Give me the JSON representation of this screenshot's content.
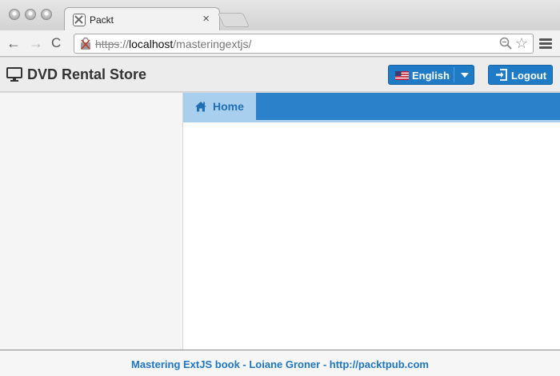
{
  "browser": {
    "tab": {
      "title": "Packt",
      "close_glyph": "×",
      "favicon": "packt-favicon"
    },
    "nav": {
      "back_glyph": "←",
      "forward_glyph": "→",
      "reload_glyph": "C"
    },
    "address": {
      "scheme": "https",
      "separator": "://",
      "host": "localhost",
      "path": "/masteringextjs/"
    },
    "icons": [
      "lock-broken-icon",
      "zoom-icon",
      "star-icon",
      "menu-icon"
    ]
  },
  "app": {
    "title": "DVD Rental Store",
    "title_icon": "monitor-icon",
    "language": {
      "label": "English",
      "icon": "us-flag-icon"
    },
    "logout": {
      "label": "Logout",
      "icon": "logout-icon"
    },
    "tabs": [
      {
        "label": "Home",
        "icon": "home-icon",
        "active": true
      }
    ],
    "footer": "Mastering ExtJS book - Loiane Groner - http://packtpub.com"
  },
  "colors": {
    "accent": "#2b82cb",
    "tab_active": "#a9cfee",
    "button": "#1f7bc6",
    "footer_text": "#1f76c0"
  }
}
